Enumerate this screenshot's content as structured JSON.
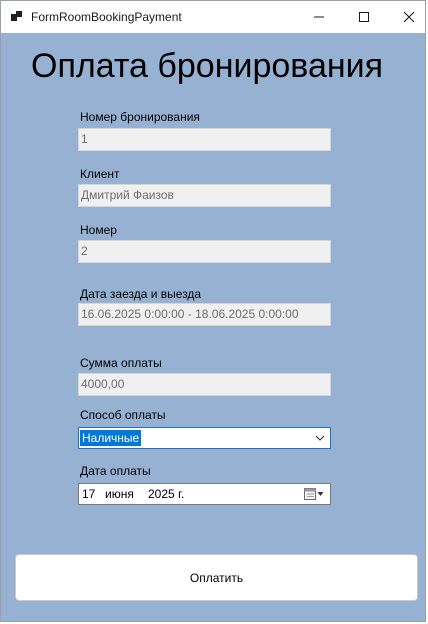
{
  "window": {
    "title": "FormRoomBookingPayment"
  },
  "form": {
    "heading": "Оплата бронирования",
    "booking_number": {
      "label": "Номер бронирования",
      "value": "1"
    },
    "client": {
      "label": "Клиент",
      "value": "Дмитрий Фаизов"
    },
    "room": {
      "label": "Номер",
      "value": "2"
    },
    "dates": {
      "label": "Дата заезда и выезда",
      "value": "16.06.2025 0:00:00 - 18.06.2025 0:00:00"
    },
    "amount": {
      "label": "Сумма оплаты",
      "value": "4000,00"
    },
    "payment_method": {
      "label": "Способ оплаты",
      "selected": "Наличные"
    },
    "payment_date": {
      "label": "Дата оплаты",
      "day": "17",
      "month": "июня",
      "year": "2025 г."
    },
    "submit_label": "Оплатить"
  },
  "icons": {
    "minimize": "minimize-icon",
    "maximize": "maximize-icon",
    "close": "close-icon",
    "dropdown": "chevron-down-icon",
    "calendar": "calendar-icon"
  }
}
